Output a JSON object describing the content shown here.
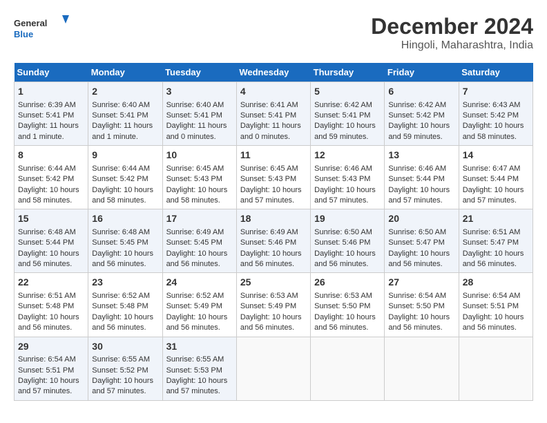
{
  "header": {
    "logo_text_general": "General",
    "logo_text_blue": "Blue",
    "month_title": "December 2024",
    "location": "Hingoli, Maharashtra, India"
  },
  "days_of_week": [
    "Sunday",
    "Monday",
    "Tuesday",
    "Wednesday",
    "Thursday",
    "Friday",
    "Saturday"
  ],
  "weeks": [
    [
      {
        "day": "1",
        "lines": [
          "Sunrise: 6:39 AM",
          "Sunset: 5:41 PM",
          "Daylight: 11 hours",
          "and 1 minute."
        ]
      },
      {
        "day": "2",
        "lines": [
          "Sunrise: 6:40 AM",
          "Sunset: 5:41 PM",
          "Daylight: 11 hours",
          "and 1 minute."
        ]
      },
      {
        "day": "3",
        "lines": [
          "Sunrise: 6:40 AM",
          "Sunset: 5:41 PM",
          "Daylight: 11 hours",
          "and 0 minutes."
        ]
      },
      {
        "day": "4",
        "lines": [
          "Sunrise: 6:41 AM",
          "Sunset: 5:41 PM",
          "Daylight: 11 hours",
          "and 0 minutes."
        ]
      },
      {
        "day": "5",
        "lines": [
          "Sunrise: 6:42 AM",
          "Sunset: 5:41 PM",
          "Daylight: 10 hours",
          "and 59 minutes."
        ]
      },
      {
        "day": "6",
        "lines": [
          "Sunrise: 6:42 AM",
          "Sunset: 5:42 PM",
          "Daylight: 10 hours",
          "and 59 minutes."
        ]
      },
      {
        "day": "7",
        "lines": [
          "Sunrise: 6:43 AM",
          "Sunset: 5:42 PM",
          "Daylight: 10 hours",
          "and 58 minutes."
        ]
      }
    ],
    [
      {
        "day": "8",
        "lines": [
          "Sunrise: 6:44 AM",
          "Sunset: 5:42 PM",
          "Daylight: 10 hours",
          "and 58 minutes."
        ]
      },
      {
        "day": "9",
        "lines": [
          "Sunrise: 6:44 AM",
          "Sunset: 5:42 PM",
          "Daylight: 10 hours",
          "and 58 minutes."
        ]
      },
      {
        "day": "10",
        "lines": [
          "Sunrise: 6:45 AM",
          "Sunset: 5:43 PM",
          "Daylight: 10 hours",
          "and 58 minutes."
        ]
      },
      {
        "day": "11",
        "lines": [
          "Sunrise: 6:45 AM",
          "Sunset: 5:43 PM",
          "Daylight: 10 hours",
          "and 57 minutes."
        ]
      },
      {
        "day": "12",
        "lines": [
          "Sunrise: 6:46 AM",
          "Sunset: 5:43 PM",
          "Daylight: 10 hours",
          "and 57 minutes."
        ]
      },
      {
        "day": "13",
        "lines": [
          "Sunrise: 6:46 AM",
          "Sunset: 5:44 PM",
          "Daylight: 10 hours",
          "and 57 minutes."
        ]
      },
      {
        "day": "14",
        "lines": [
          "Sunrise: 6:47 AM",
          "Sunset: 5:44 PM",
          "Daylight: 10 hours",
          "and 57 minutes."
        ]
      }
    ],
    [
      {
        "day": "15",
        "lines": [
          "Sunrise: 6:48 AM",
          "Sunset: 5:44 PM",
          "Daylight: 10 hours",
          "and 56 minutes."
        ]
      },
      {
        "day": "16",
        "lines": [
          "Sunrise: 6:48 AM",
          "Sunset: 5:45 PM",
          "Daylight: 10 hours",
          "and 56 minutes."
        ]
      },
      {
        "day": "17",
        "lines": [
          "Sunrise: 6:49 AM",
          "Sunset: 5:45 PM",
          "Daylight: 10 hours",
          "and 56 minutes."
        ]
      },
      {
        "day": "18",
        "lines": [
          "Sunrise: 6:49 AM",
          "Sunset: 5:46 PM",
          "Daylight: 10 hours",
          "and 56 minutes."
        ]
      },
      {
        "day": "19",
        "lines": [
          "Sunrise: 6:50 AM",
          "Sunset: 5:46 PM",
          "Daylight: 10 hours",
          "and 56 minutes."
        ]
      },
      {
        "day": "20",
        "lines": [
          "Sunrise: 6:50 AM",
          "Sunset: 5:47 PM",
          "Daylight: 10 hours",
          "and 56 minutes."
        ]
      },
      {
        "day": "21",
        "lines": [
          "Sunrise: 6:51 AM",
          "Sunset: 5:47 PM",
          "Daylight: 10 hours",
          "and 56 minutes."
        ]
      }
    ],
    [
      {
        "day": "22",
        "lines": [
          "Sunrise: 6:51 AM",
          "Sunset: 5:48 PM",
          "Daylight: 10 hours",
          "and 56 minutes."
        ]
      },
      {
        "day": "23",
        "lines": [
          "Sunrise: 6:52 AM",
          "Sunset: 5:48 PM",
          "Daylight: 10 hours",
          "and 56 minutes."
        ]
      },
      {
        "day": "24",
        "lines": [
          "Sunrise: 6:52 AM",
          "Sunset: 5:49 PM",
          "Daylight: 10 hours",
          "and 56 minutes."
        ]
      },
      {
        "day": "25",
        "lines": [
          "Sunrise: 6:53 AM",
          "Sunset: 5:49 PM",
          "Daylight: 10 hours",
          "and 56 minutes."
        ]
      },
      {
        "day": "26",
        "lines": [
          "Sunrise: 6:53 AM",
          "Sunset: 5:50 PM",
          "Daylight: 10 hours",
          "and 56 minutes."
        ]
      },
      {
        "day": "27",
        "lines": [
          "Sunrise: 6:54 AM",
          "Sunset: 5:50 PM",
          "Daylight: 10 hours",
          "and 56 minutes."
        ]
      },
      {
        "day": "28",
        "lines": [
          "Sunrise: 6:54 AM",
          "Sunset: 5:51 PM",
          "Daylight: 10 hours",
          "and 56 minutes."
        ]
      }
    ],
    [
      {
        "day": "29",
        "lines": [
          "Sunrise: 6:54 AM",
          "Sunset: 5:51 PM",
          "Daylight: 10 hours",
          "and 57 minutes."
        ]
      },
      {
        "day": "30",
        "lines": [
          "Sunrise: 6:55 AM",
          "Sunset: 5:52 PM",
          "Daylight: 10 hours",
          "and 57 minutes."
        ]
      },
      {
        "day": "31",
        "lines": [
          "Sunrise: 6:55 AM",
          "Sunset: 5:53 PM",
          "Daylight: 10 hours",
          "and 57 minutes."
        ]
      },
      {
        "day": "",
        "lines": []
      },
      {
        "day": "",
        "lines": []
      },
      {
        "day": "",
        "lines": []
      },
      {
        "day": "",
        "lines": []
      }
    ]
  ]
}
